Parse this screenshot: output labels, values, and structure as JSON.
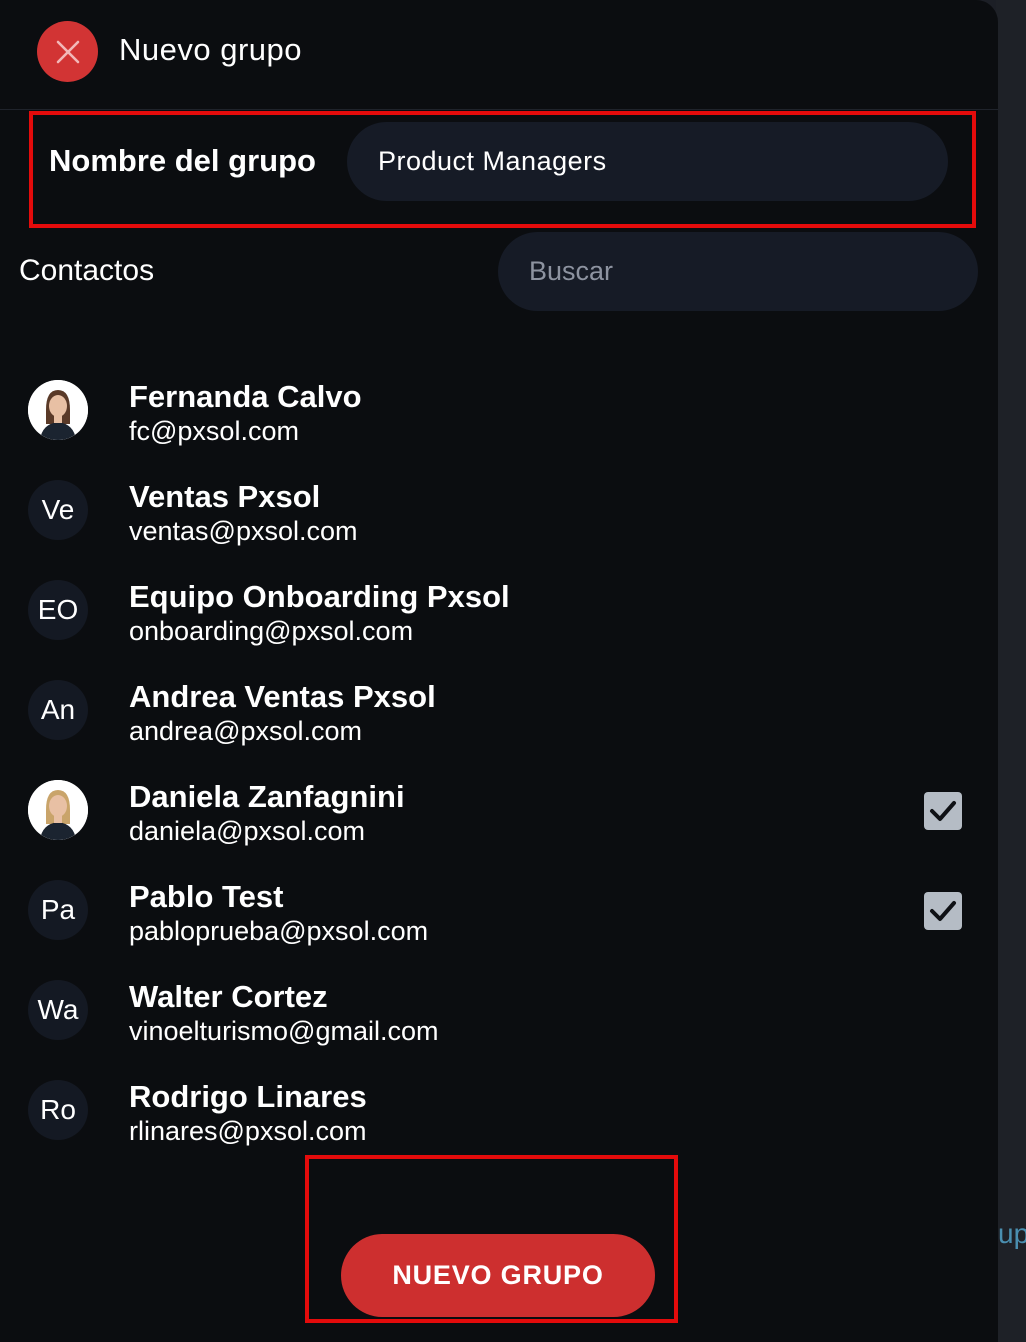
{
  "header": {
    "title": "Nuevo grupo",
    "close_icon": "close-icon"
  },
  "group_name": {
    "label": "Nombre del grupo",
    "value": "Product Managers"
  },
  "contacts_section": {
    "label": "Contactos",
    "search_placeholder": "Buscar"
  },
  "contacts": [
    {
      "initials": "",
      "photo": true,
      "name": "Fernanda Calvo",
      "email": "fc@pxsol.com",
      "checked": false
    },
    {
      "initials": "Ve",
      "photo": false,
      "name": "Ventas Pxsol",
      "email": "ventas@pxsol.com",
      "checked": false
    },
    {
      "initials": "EO",
      "photo": false,
      "name": "Equipo Onboarding Pxsol",
      "email": "onboarding@pxsol.com",
      "checked": false
    },
    {
      "initials": "An",
      "photo": false,
      "name": "Andrea Ventas Pxsol",
      "email": "andrea@pxsol.com",
      "checked": false
    },
    {
      "initials": "",
      "photo": true,
      "name": "Daniela Zanfagnini",
      "email": "daniela@pxsol.com",
      "checked": true
    },
    {
      "initials": "Pa",
      "photo": false,
      "name": "Pablo Test",
      "email": "pabloprueba@pxsol.com",
      "checked": true
    },
    {
      "initials": "Wa",
      "photo": false,
      "name": "Walter Cortez",
      "email": "vinoelturismo@gmail.com",
      "checked": false
    },
    {
      "initials": "Ro",
      "photo": false,
      "name": "Rodrigo Linares",
      "email": "rlinares@pxsol.com",
      "checked": false
    }
  ],
  "footer": {
    "button_label": "NUEVO GRUPO"
  },
  "backdrop": {
    "partial_text": "up"
  },
  "colors": {
    "panel_bg": "#0b0d10",
    "input_bg": "#161b26",
    "accent_red": "#d23434",
    "highlight_red": "#e40b0b",
    "checkbox_bg": "#b5bcc5"
  }
}
